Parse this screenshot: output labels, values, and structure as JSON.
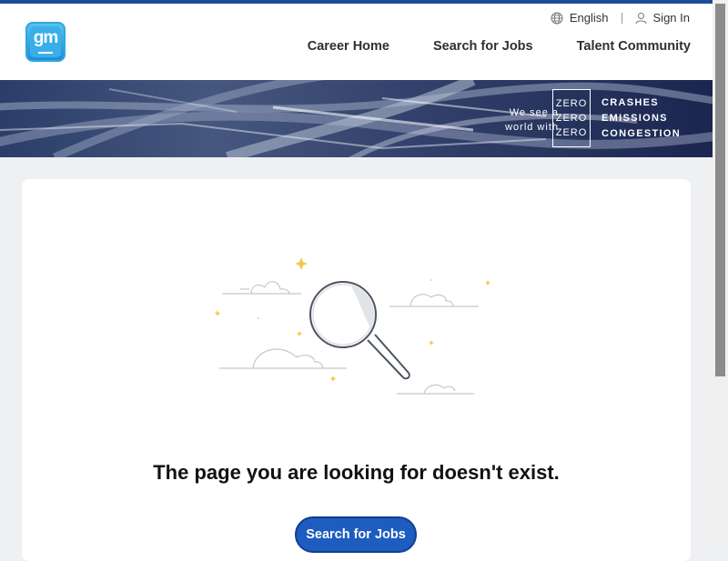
{
  "brand": {
    "logo_text": "gm"
  },
  "utility": {
    "language": "English",
    "sign_in": "Sign In"
  },
  "nav": {
    "items": [
      "Career Home",
      "Search for Jobs",
      "Talent Community"
    ]
  },
  "banner": {
    "tagline_line1": "We see a",
    "tagline_line2": "world with",
    "zero": [
      "ZERO",
      "ZERO",
      "ZERO"
    ],
    "words": [
      "CRASHES",
      "EMISSIONS",
      "CONGESTION"
    ]
  },
  "error": {
    "message": "The page you are looking for doesn't exist."
  },
  "cta": {
    "label": "Search for Jobs"
  },
  "colors": {
    "accent": "#1e5dbf",
    "logo": "#2fa6e0",
    "top_stripe": "#1d4d9a"
  }
}
